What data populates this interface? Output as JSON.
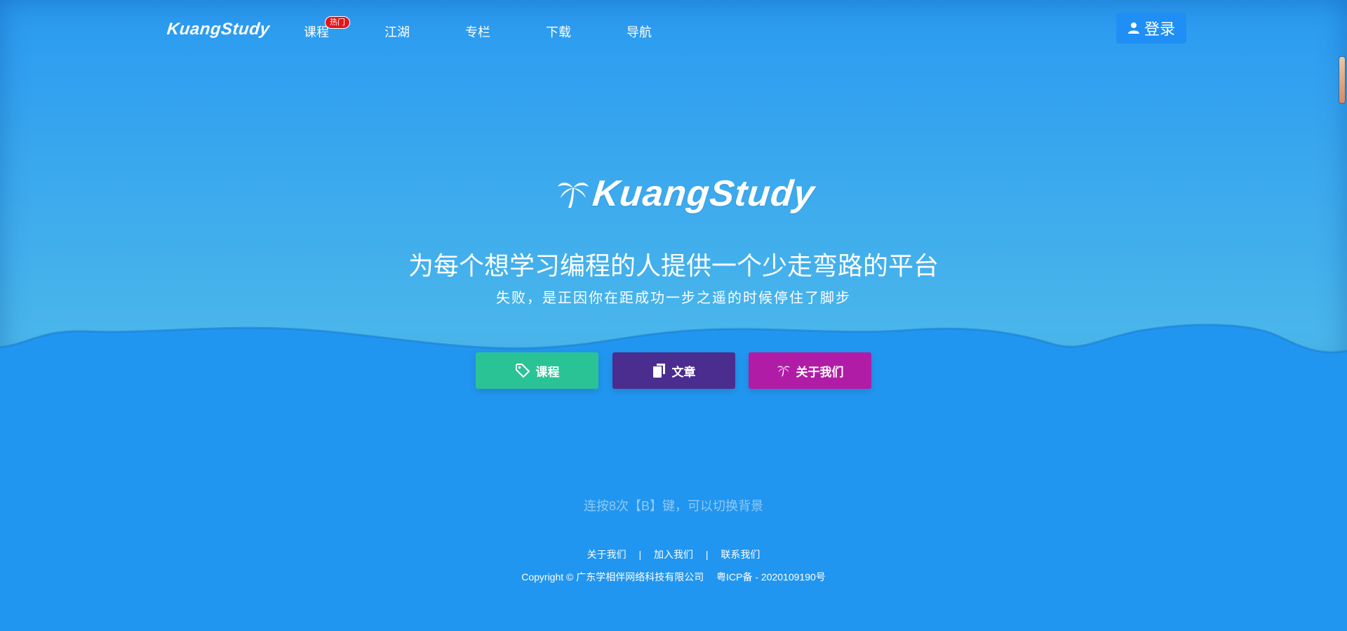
{
  "nav": {
    "brand": "KuangStudy",
    "items": [
      {
        "label": "课程"
      },
      {
        "label": "江湖"
      },
      {
        "label": "专栏"
      },
      {
        "label": "下载"
      },
      {
        "label": "导航"
      }
    ],
    "hot_badge": "热门",
    "login_label": "登录"
  },
  "hero": {
    "logo_text": "KuangStudy",
    "title": "为每个想学习编程的人提供一个少走弯路的平台",
    "subtitle": "失败，是正因你在距成功一步之遥的时候停住了脚步"
  },
  "buttons": {
    "course": "课程",
    "article": "文章",
    "about": "关于我们"
  },
  "hint": "连按8次【B】键，可以切换背景",
  "footer": {
    "links": [
      "关于我们",
      "加入我们",
      "联系我们"
    ],
    "separator": "|",
    "copyright": "Copyright © 广东学相伴网络科技有限公司",
    "icp": "粤ICP备 - 2020109190号"
  },
  "colors": {
    "background": "#2196f0",
    "course_button": "#2ac396",
    "article_button": "#4a2d8f",
    "about_button": "#b01ca6",
    "hot_badge": "#e4151b"
  }
}
